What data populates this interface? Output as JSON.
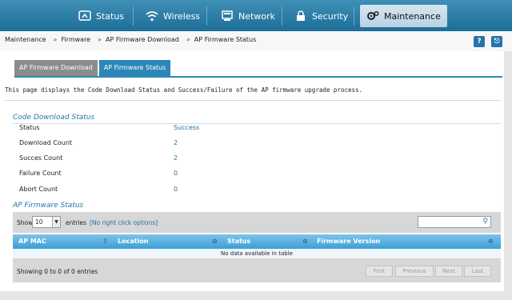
{
  "nav": {
    "items": [
      {
        "label": "Status",
        "icon": "gauge-icon"
      },
      {
        "label": "Wireless",
        "icon": "wifi-icon"
      },
      {
        "label": "Network",
        "icon": "network-icon"
      },
      {
        "label": "Security",
        "icon": "lock-icon"
      },
      {
        "label": "Maintenance",
        "icon": "gears-icon"
      }
    ],
    "active": "Maintenance"
  },
  "breadcrumb": {
    "items": [
      "Maintenance",
      "Firmware",
      "AP Firmware Download",
      "AP Firmware Status"
    ],
    "separator": "»",
    "help_label": "?",
    "logout_label": "⎋"
  },
  "tabs": [
    {
      "label": "AP Firmware Download",
      "active": false
    },
    {
      "label": "AP Firmware Status",
      "active": true
    }
  ],
  "description": "This page displays the Code Download Status and Success/Failure of the AP firmware upgrade process.",
  "code_status": {
    "heading": "Code Download Status",
    "rows": [
      {
        "label": "Status",
        "value": "Success"
      },
      {
        "label": "Download Count",
        "value": "2"
      },
      {
        "label": "Succes Count",
        "value": "2"
      },
      {
        "label": "Failure Count",
        "value": "0"
      },
      {
        "label": "Abort Count",
        "value": "0"
      }
    ]
  },
  "fw_status": {
    "heading": "AP Firmware Status",
    "show_label": "Show",
    "page_size": "10",
    "entries_label": "entries",
    "no_right_click": "[No right click options]",
    "search_placeholder": "",
    "columns": [
      "AP MAC",
      "Location",
      "Status",
      "Firmware Version"
    ],
    "empty_message": "No data available in table",
    "info": "Showing 0 to 0 of 0 entries",
    "pager": [
      "First",
      "Previous",
      "Next",
      "Last"
    ]
  },
  "colors": {
    "nav_bg": "#1d6e98",
    "accent": "#2a87b8",
    "link": "#1f77a8"
  }
}
